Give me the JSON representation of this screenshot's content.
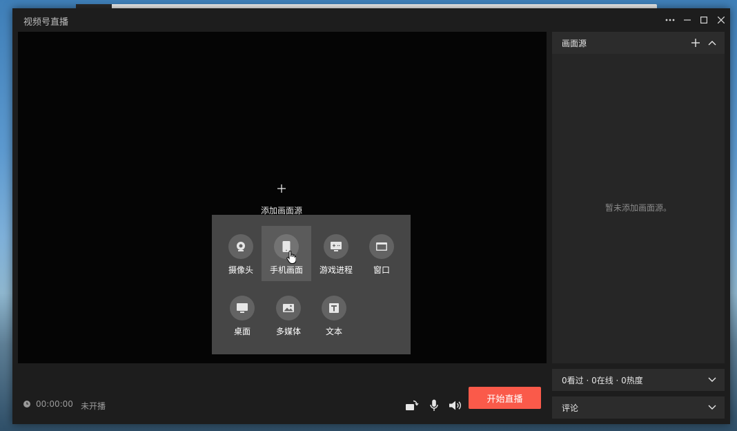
{
  "window": {
    "title": "视频号直播"
  },
  "preview": {
    "add_icon": "plus-icon",
    "add_label": "添加画面源"
  },
  "source_menu": {
    "items": [
      {
        "label": "摄像头",
        "icon": "camera-icon"
      },
      {
        "label": "手机画面",
        "icon": "phone-icon",
        "hovered": true
      },
      {
        "label": "游戏进程",
        "icon": "game-icon"
      },
      {
        "label": "窗口",
        "icon": "window-icon"
      },
      {
        "label": "桌面",
        "icon": "desktop-icon"
      },
      {
        "label": "多媒体",
        "icon": "image-icon"
      },
      {
        "label": "文本",
        "icon": "text-icon"
      }
    ]
  },
  "bottom": {
    "timer": "00:00:00",
    "status": "未开播",
    "start_button": "开始直播"
  },
  "side_panel": {
    "title": "画面源",
    "empty_message": "暂未添加画面源。"
  },
  "stats": {
    "text": "0看过 · 0在线 · 0热度"
  },
  "comments": {
    "label": "评论"
  },
  "colors": {
    "accent": "#fa5a4a",
    "window_bg": "#1d1d1d",
    "menu_bg": "#464646"
  }
}
